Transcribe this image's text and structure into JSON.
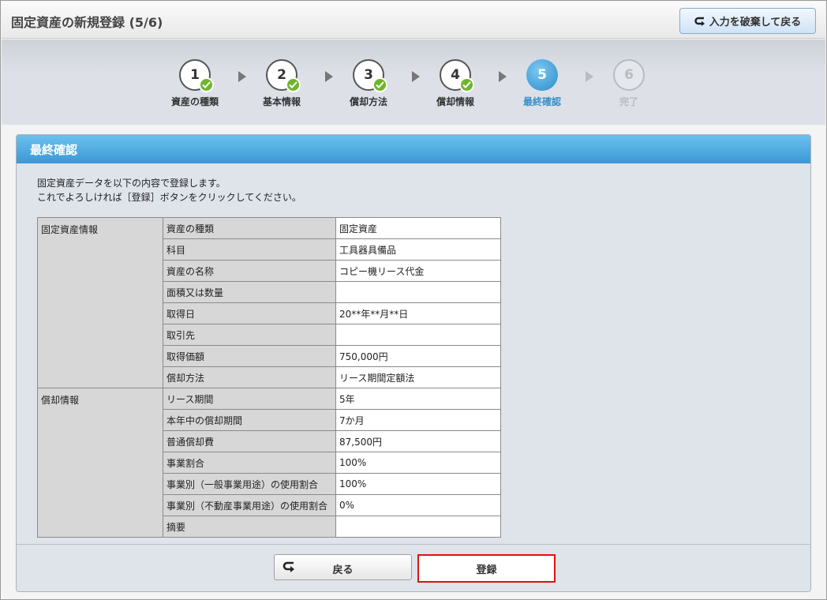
{
  "header": {
    "title": "固定資産の新規登録 (5/6)",
    "discard_button": "入力を破棄して戻る"
  },
  "steps": [
    {
      "number": "1",
      "label": "資産の種類",
      "state": "done"
    },
    {
      "number": "2",
      "label": "基本情報",
      "state": "done"
    },
    {
      "number": "3",
      "label": "償却方法",
      "state": "done"
    },
    {
      "number": "4",
      "label": "償却情報",
      "state": "done"
    },
    {
      "number": "5",
      "label": "最終確認",
      "state": "current"
    },
    {
      "number": "6",
      "label": "完了",
      "state": "future"
    }
  ],
  "panel": {
    "title": "最終確認",
    "intro_line1": "固定資産データを以下の内容で登録します。",
    "intro_line2": "これでよろしければ［登録］ボタンをクリックしてください。"
  },
  "table": {
    "group1": "固定資産情報",
    "group2": "償却情報",
    "rows": [
      {
        "key": "資産の種類",
        "value": "固定資産"
      },
      {
        "key": "科目",
        "value": "工具器具備品"
      },
      {
        "key": "資産の名称",
        "value": "コピー機リース代金"
      },
      {
        "key": "面積又は数量",
        "value": ""
      },
      {
        "key": "取得日",
        "value": "20**年**月**日"
      },
      {
        "key": "取引先",
        "value": ""
      },
      {
        "key": "取得価額",
        "value": "750,000円"
      },
      {
        "key": "償却方法",
        "value": "リース期間定額法"
      },
      {
        "key": "リース期間",
        "value": "5年"
      },
      {
        "key": "本年中の償却期間",
        "value": "7か月"
      },
      {
        "key": "普通償却費",
        "value": "87,500円"
      },
      {
        "key": "事業割合",
        "value": "100%"
      },
      {
        "key": "事業別（一般事業用途）の使用割合",
        "value": "100%"
      },
      {
        "key": "事業別（不動産事業用途）の使用割合",
        "value": "0%"
      },
      {
        "key": "摘要",
        "value": ""
      }
    ]
  },
  "footer": {
    "back_button": "戻る",
    "submit_button": "登録"
  },
  "colors": {
    "accent": "#3b98d6",
    "check": "#6fb52c",
    "highlight": "#e01010"
  }
}
